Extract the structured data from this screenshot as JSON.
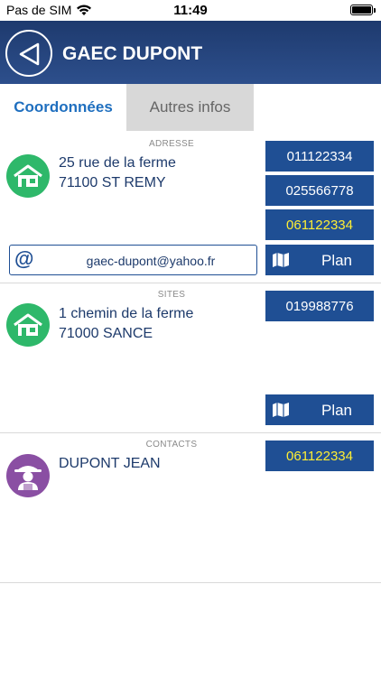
{
  "status": {
    "carrier": "Pas de SIM",
    "time": "11:49"
  },
  "header": {
    "title": "GAEC DUPONT"
  },
  "tabs": [
    {
      "label": "Coordonnées",
      "active": true
    },
    {
      "label": "Autres infos",
      "active": false
    }
  ],
  "adresse": {
    "label": "ADRESSE",
    "line1": "25 rue de la ferme",
    "line2": "71100 ST REMY",
    "phones": [
      "011122334",
      "025566778",
      "061122334"
    ],
    "email": "gaec-dupont@yahoo.fr",
    "plan_label": "Plan"
  },
  "sites": {
    "label": "SITES",
    "line1": "1 chemin de la ferme",
    "line2": "71000 SANCE",
    "phone": "019988776",
    "plan_label": "Plan"
  },
  "contacts": {
    "label": "CONTACTS",
    "name": "DUPONT JEAN",
    "phone": "061122334"
  },
  "colors": {
    "header": "#2d4f8c",
    "button": "#1f4f94",
    "mobile_text": "#ffee33",
    "tab_active": "#1f6fbf",
    "house_avatar": "#2eb86a",
    "contact_avatar": "#8a4fa3"
  }
}
